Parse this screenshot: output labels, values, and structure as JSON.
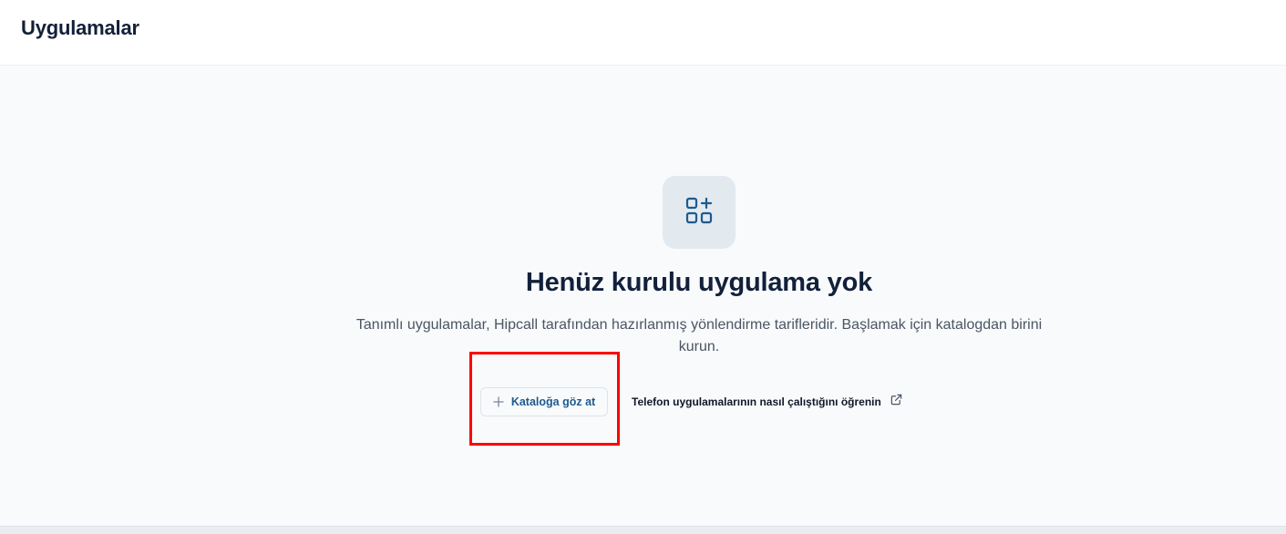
{
  "header": {
    "title": "Uygulamalar"
  },
  "empty_state": {
    "icon": "apps-add-icon",
    "title": "Henüz kurulu uygulama yok",
    "description": "Tanımlı uygulamalar, Hipcall tarafından hazırlanmış yönlendirme tarifleridir. Başlamak için katalogdan birini kurun."
  },
  "actions": {
    "browse_catalog": {
      "icon": "plus-icon",
      "label": "Kataloğa göz at"
    },
    "learn_more": {
      "label": "Telefon uygulamalarının nasıl çalıştığını öğrenin",
      "icon": "external-link-icon"
    }
  },
  "colors": {
    "accent": "#1f5a8e",
    "highlight": "#ff0000",
    "icon_bg": "#e2e9ef"
  }
}
